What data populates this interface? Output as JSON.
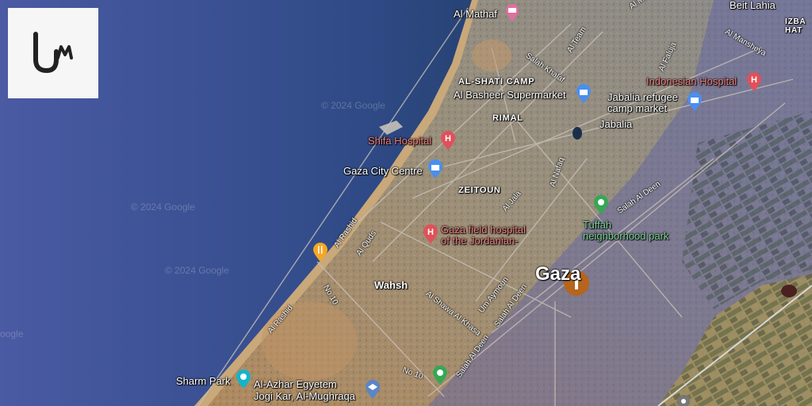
{
  "brand": {
    "logo_text": "UM",
    "logo_color": "#222222"
  },
  "watermarks": [
    "© 2024 Google",
    "© 2024 Google",
    "© 2024 Google",
    "oogle"
  ],
  "places": {
    "beit_lahia": "Beit Lahia",
    "izbat": "IZBA\nHAT",
    "al_mathaf": "Al Mathaf",
    "al_shati_camp": "AL-SHATI CAMP",
    "al_basheer": "Al Basheer Supermarket",
    "indonesian_hospital": "Indonesian Hospital",
    "jabalia_camp_market": "Jabalia refugee\ncamp market",
    "rimal": "RIMAL",
    "jabalia": "Jabalia",
    "shifa_hospital": "Shifa Hospital",
    "gaza_city_centre": "Gaza City Centre",
    "zeitoun": "ZEITOUN",
    "tuffah_park": "Tuffah\nneighborhood park",
    "gaza_field_hospital": "Gaza field hospital\nof the Jordanian-",
    "gaza": "Gaza",
    "wahsh": "Wahsh",
    "sharm_park": "Sharm Park",
    "al_azhar": "Al-Azhar Egyetem\nJogi Kar, Al-Mughraqa"
  },
  "roads": {
    "al_manshiya": "Al Mansheya",
    "al_team": "Al Team",
    "salah_khalaf": "Salah Khalaf",
    "al_faluja": "Al Faluja",
    "al_jala": "Al Jala",
    "al_nafaq": "Al Nafaq",
    "salah_al_deen_ne": "Salah Al Deen",
    "al_rashid_n": "Al Rashid",
    "al_quds": "Al Quds",
    "al_rashid_s": "Al Rashid",
    "no_10_n": "No 10",
    "no_10_s": "No 10",
    "al_shawa_al_khasa": "Al Shawa Al Khasa",
    "um_aymoun": "Um Aymoun",
    "salah_al_deen_c": "Salah Al Deen",
    "salah_al_deen_s": "Salah Al Deen"
  },
  "colors": {
    "sea": "#2b3f7a",
    "land": "#a08a6a",
    "overlay": "#5a5fa8",
    "hospital_pin": "#e0505a",
    "shop_pin": "#4a8ef0",
    "park_pin": "#34a853",
    "food_pin": "#f5a623",
    "marker": "#b5651d",
    "museum_pin": "#e06fa0",
    "teal_pin": "#12b5cb",
    "school_pin": "#5c85c8"
  }
}
